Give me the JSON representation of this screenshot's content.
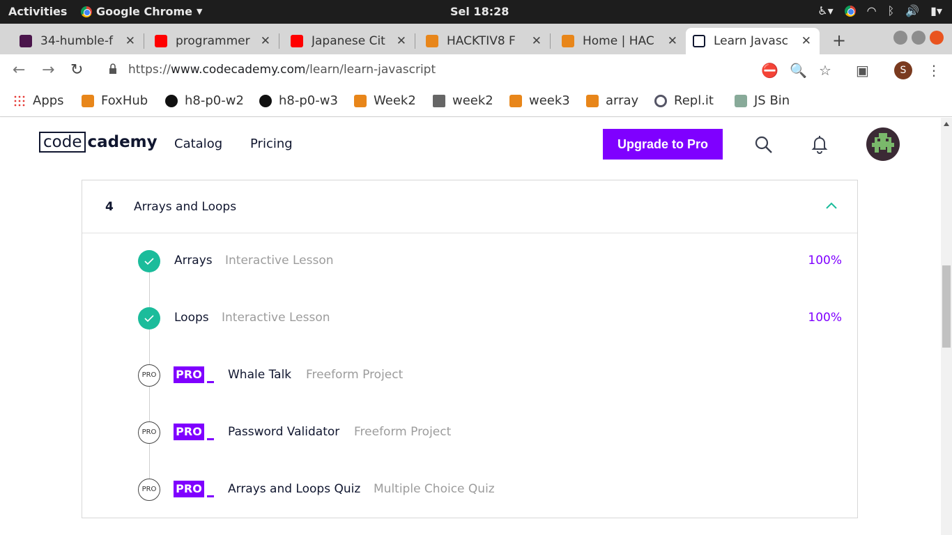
{
  "os": {
    "activities": "Activities",
    "app_name": "Google Chrome",
    "clock": "Sel 18:28"
  },
  "tabs": [
    {
      "label": "34-humble-f",
      "icon": "slack-icon"
    },
    {
      "label": "programmer",
      "icon": "youtube-icon"
    },
    {
      "label": "Japanese Cit",
      "icon": "youtube-icon"
    },
    {
      "label": "HACKTIV8 F",
      "icon": "fox-icon"
    },
    {
      "label": "Home | HAC",
      "icon": "fox-icon"
    },
    {
      "label": "Learn Javasc",
      "icon": "codecademy-icon",
      "active": true
    }
  ],
  "address": {
    "scheme": "https://",
    "host": "www.codecademy.com",
    "path": "/learn/learn-javascript"
  },
  "profile_initial": "S",
  "bookmarks": [
    {
      "label": "Apps",
      "icon": "apps-icon"
    },
    {
      "label": "FoxHub",
      "icon": "fox-icon"
    },
    {
      "label": "h8-p0-w2",
      "icon": "github-icon"
    },
    {
      "label": "h8-p0-w3",
      "icon": "github-icon"
    },
    {
      "label": "Week2",
      "icon": "fox-icon"
    },
    {
      "label": "week2",
      "icon": "folder-icon"
    },
    {
      "label": "week3",
      "icon": "fox-icon"
    },
    {
      "label": "array",
      "icon": "fox-icon"
    },
    {
      "label": "Repl.it",
      "icon": "replit-icon"
    },
    {
      "label": "JS Bin",
      "icon": "jsbin-icon"
    }
  ],
  "header": {
    "logo_box": "code",
    "logo_rest": "cademy",
    "nav": [
      "Catalog",
      "Pricing"
    ],
    "upgrade_label": "Upgrade to Pro"
  },
  "module": {
    "number": "4",
    "title": "Arrays and Loops",
    "items": [
      {
        "title": "Arrays",
        "type": "Interactive Lesson",
        "progress": "100%",
        "completed": true
      },
      {
        "title": "Loops",
        "type": "Interactive Lesson",
        "progress": "100%",
        "completed": true
      },
      {
        "title": "Whale Talk",
        "type": "Freeform Project",
        "pro": true,
        "circle_label": "PRO",
        "badge": "PRO"
      },
      {
        "title": "Password Validator",
        "type": "Freeform Project",
        "pro": true,
        "circle_label": "PRO",
        "badge": "PRO"
      },
      {
        "title": "Arrays and Loops Quiz",
        "type": "Multiple Choice Quiz",
        "pro": true,
        "circle_label": "PRO",
        "badge": "PRO"
      }
    ]
  },
  "colors": {
    "accent": "#7f00ff",
    "success": "#1bbc9b",
    "navy": "#10162f"
  }
}
